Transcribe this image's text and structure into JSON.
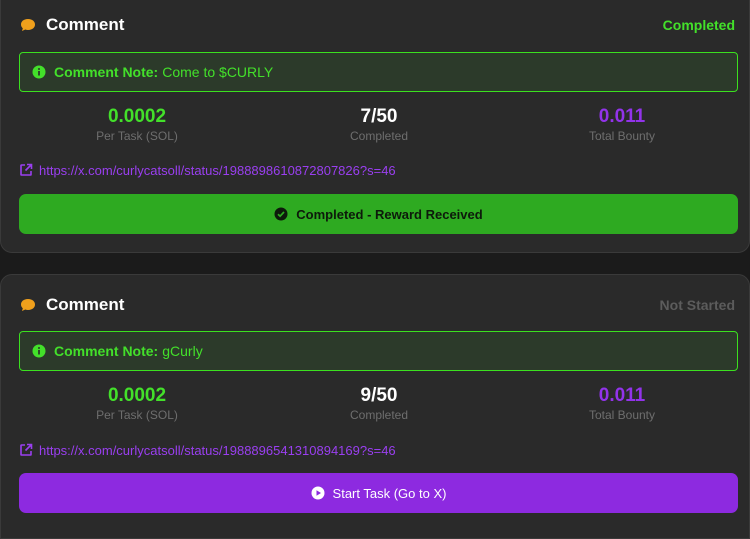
{
  "tasks": [
    {
      "title": "Comment",
      "status": "Completed",
      "note_label": "Comment Note:",
      "note_text": "Come to $CURLY",
      "stats": [
        {
          "value": "0.0002",
          "label": "Per Task (SOL)"
        },
        {
          "value": "7/50",
          "label": "Completed"
        },
        {
          "value": "0.011",
          "label": "Total Bounty"
        }
      ],
      "link": "https://x.com/curlycatsoll/status/1988898610872807826?s=46",
      "button_label": "Completed - Reward Received",
      "button_icon": "check-circle-icon"
    },
    {
      "title": "Comment",
      "status": "Not Started",
      "note_label": "Comment Note:",
      "note_text": "gCurly",
      "stats": [
        {
          "value": "0.0002",
          "label": "Per Task (SOL)"
        },
        {
          "value": "9/50",
          "label": "Completed"
        },
        {
          "value": "0.011",
          "label": "Total Bounty"
        }
      ],
      "link": "https://x.com/curlycatsoll/status/1988896541310894169?s=46",
      "button_label": "Start Task (Go to X)",
      "button_icon": "play-circle-icon"
    }
  ],
  "colors": {
    "accent_green": "#43e02a",
    "accent_purple": "#9233ea",
    "chat_icon": "#f0a01c",
    "card_bg": "#2a2a2a"
  }
}
